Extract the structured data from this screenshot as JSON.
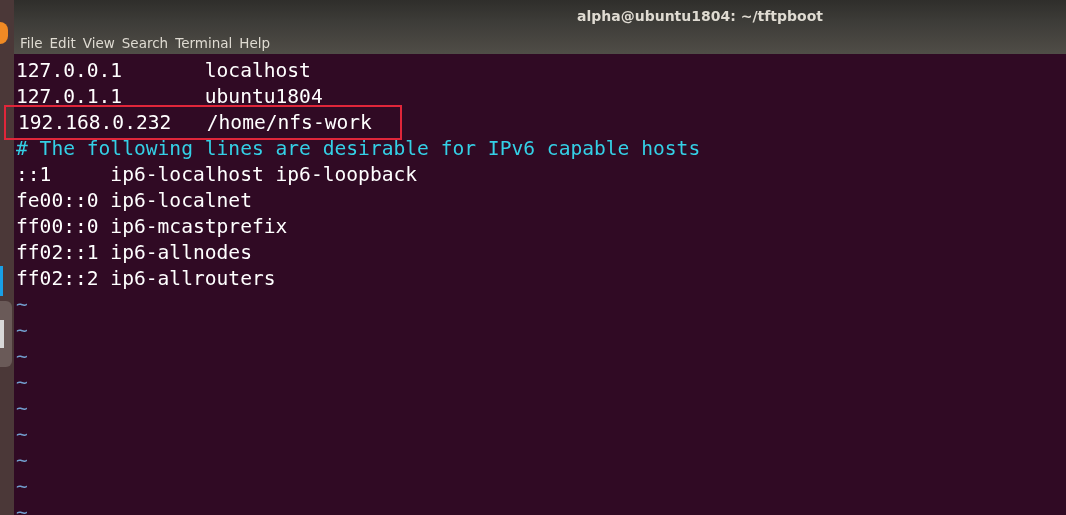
{
  "window": {
    "title": "alpha@ubuntu1804: ~/tftpboot"
  },
  "menu": [
    "File",
    "Edit",
    "View",
    "Search",
    "Terminal",
    "Help"
  ],
  "lines": [
    {
      "kind": "text",
      "text": "127.0.0.1       localhost",
      "boxed": false
    },
    {
      "kind": "text",
      "text": "127.0.1.1       ubuntu1804",
      "boxed": false
    },
    {
      "kind": "text",
      "text": "192.168.0.232   /home/nfs-work",
      "boxed": true
    },
    {
      "kind": "comment",
      "text": "# The following lines are desirable for IPv6 capable hosts",
      "boxed": false
    },
    {
      "kind": "text",
      "text": "::1     ip6-localhost ip6-loopback",
      "boxed": false
    },
    {
      "kind": "text",
      "text": "fe00::0 ip6-localnet",
      "boxed": false
    },
    {
      "kind": "text",
      "text": "ff00::0 ip6-mcastprefix",
      "boxed": false
    },
    {
      "kind": "text",
      "text": "ff02::1 ip6-allnodes",
      "boxed": false
    },
    {
      "kind": "text",
      "text": "ff02::2 ip6-allrouters",
      "boxed": false
    },
    {
      "kind": "tilde",
      "text": "~",
      "boxed": false
    },
    {
      "kind": "tilde",
      "text": "~",
      "boxed": false
    },
    {
      "kind": "tilde",
      "text": "~",
      "boxed": false
    },
    {
      "kind": "tilde",
      "text": "~",
      "boxed": false
    },
    {
      "kind": "tilde",
      "text": "~",
      "boxed": false
    },
    {
      "kind": "tilde",
      "text": "~",
      "boxed": false
    },
    {
      "kind": "tilde",
      "text": "~",
      "boxed": false
    },
    {
      "kind": "tilde",
      "text": "~",
      "boxed": false
    },
    {
      "kind": "tilde",
      "text": "~",
      "boxed": false
    }
  ]
}
